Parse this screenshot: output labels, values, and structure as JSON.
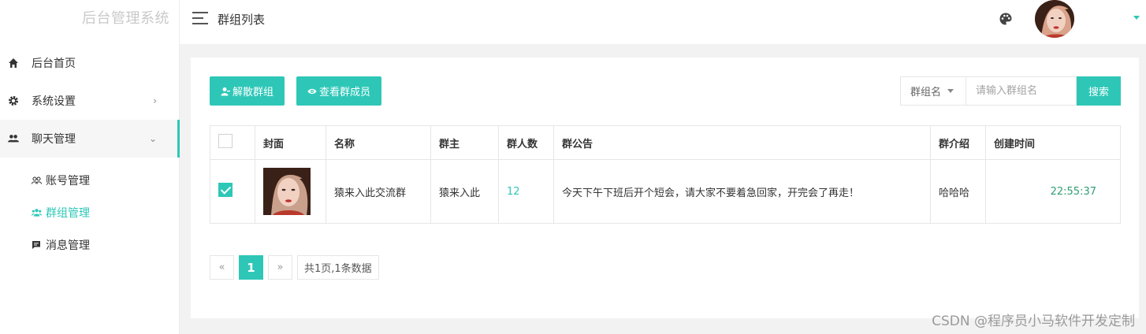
{
  "app": {
    "title": "后台管理系统"
  },
  "sidebar": {
    "items": [
      {
        "label": "后台首页",
        "icon": "home-icon"
      },
      {
        "label": "系统设置",
        "icon": "gear-icon",
        "arrow": "›"
      },
      {
        "label": "聊天管理",
        "icon": "users-icon",
        "arrow": "⌄"
      }
    ],
    "sub_items": [
      {
        "label": "账号管理",
        "icon": "accounts-icon"
      },
      {
        "label": "群组管理",
        "icon": "group-icon",
        "active": true
      },
      {
        "label": "消息管理",
        "icon": "message-icon"
      }
    ]
  },
  "header": {
    "page_title": "群组列表"
  },
  "toolbar": {
    "dissolve_label": "解散群组",
    "members_label": "查看群成员",
    "search_field_label": "群组名",
    "search_placeholder": "请输入群组名",
    "search_button": "搜索"
  },
  "table": {
    "columns": [
      "封面",
      "名称",
      "群主",
      "群人数",
      "群公告",
      "群介绍",
      "创建时间"
    ],
    "rows": [
      {
        "checked": true,
        "name": "猿来入此交流群",
        "owner": "猿来入此",
        "member_count": "12",
        "notice": "今天下午下班后开个短会，请大家不要着急回家，开完会了再走！",
        "intro": "哈哈哈",
        "created": "22:55:37"
      }
    ]
  },
  "pagination": {
    "prev": "«",
    "current": "1",
    "next": "»",
    "info": "共1页,1条数据"
  },
  "watermark": "CSDN @程序员小马软件开发定制",
  "colors": {
    "accent": "#2ec7b7"
  }
}
